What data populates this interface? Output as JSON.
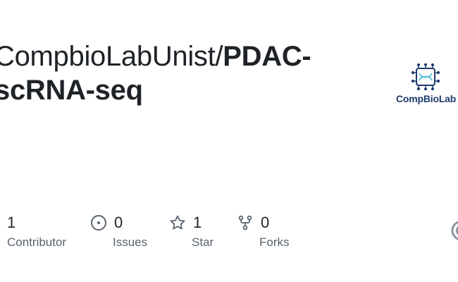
{
  "repo": {
    "owner": "CompbioLabUnist/",
    "name_line1": "PDAC-",
    "name_line2": "scRNA-seq"
  },
  "logo": {
    "text": "CompBioLab",
    "icon": "dna-chip-icon",
    "color": "#1e3a6e",
    "accent": "#5bc0de"
  },
  "stats": {
    "contributors": {
      "value": "1",
      "label": "Contributor",
      "icon": "people-icon"
    },
    "issues": {
      "value": "0",
      "label": "Issues",
      "icon": "issue-opened-icon"
    },
    "stars": {
      "value": "1",
      "label": "Star",
      "icon": "star-icon"
    },
    "forks": {
      "value": "0",
      "label": "Forks",
      "icon": "repo-forked-icon"
    }
  },
  "colors": {
    "text": "#1f2328",
    "muted": "#59636e",
    "icon": "#59636e"
  }
}
